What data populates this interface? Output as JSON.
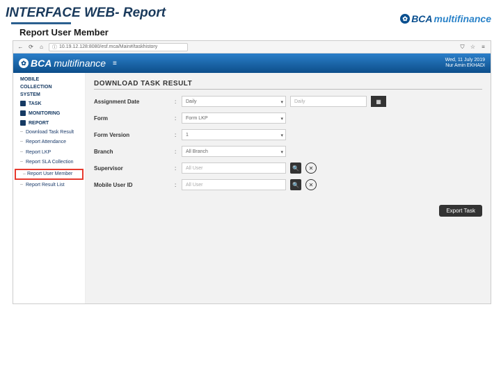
{
  "slide": {
    "title": "INTERFACE WEB- Report",
    "subtitle": "Report User Member",
    "brand_prefix": "BCA",
    "brand_suffix": "multifinance"
  },
  "browser": {
    "url": "10.19.12.128:8080/esf.mca/Main#/taskhistory"
  },
  "app_header": {
    "logo_prefix": "BCA",
    "logo_suffix": "multifinance",
    "date_line": "Wed, 11 July 2019",
    "user_line": "Nur Amin EKHADI"
  },
  "sidebar": {
    "system_title1": "MOBILE",
    "system_title2": "COLLECTION",
    "system_title3": "SYSTEM",
    "items": [
      {
        "label": "TASK"
      },
      {
        "label": "MONITORING"
      },
      {
        "label": "REPORT"
      }
    ],
    "report_children": [
      {
        "label": "Download Task Result"
      },
      {
        "label": "Report Attendance"
      },
      {
        "label": "Report LKP"
      },
      {
        "label": "Report SLA Collection"
      },
      {
        "label": "Report User Member"
      },
      {
        "label": "Report Result List"
      }
    ]
  },
  "panel": {
    "title": "DOWNLOAD TASK RESULT",
    "rows": {
      "assignment_date": {
        "label": "Assignment Date",
        "value": "Daily",
        "date_value": "Daily"
      },
      "form": {
        "label": "Form",
        "value": "Form LKP"
      },
      "form_version": {
        "label": "Form Version",
        "value": "1"
      },
      "branch": {
        "label": "Branch",
        "value": "All Branch"
      },
      "supervisor": {
        "label": "Supervisor",
        "placeholder": "All User"
      },
      "mobile_user": {
        "label": "Mobile User ID",
        "placeholder": "All User"
      }
    },
    "export_label": "Export Task"
  }
}
